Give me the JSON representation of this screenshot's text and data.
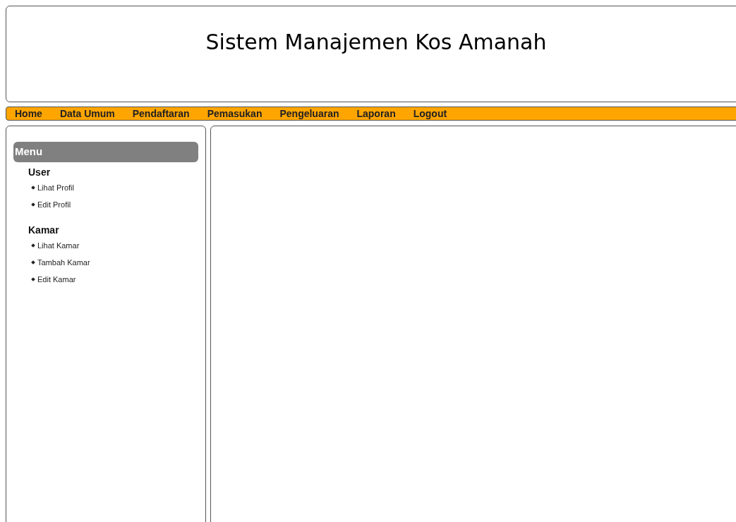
{
  "header": {
    "title": "Sistem Manajemen Kos Amanah"
  },
  "nav": [
    "Home",
    "Data Umum",
    "Pendaftaran",
    "Pemasukan",
    "Pengeluaran",
    "Laporan",
    "Logout"
  ],
  "sidebar": {
    "title": "Menu",
    "groups": [
      {
        "label": "User",
        "items": [
          "Lihat Profil",
          "Edit Profil"
        ]
      },
      {
        "label": "Kamar",
        "items": [
          "Lihat Kamar",
          "Tambah Kamar",
          "Edit Kamar"
        ]
      }
    ]
  }
}
